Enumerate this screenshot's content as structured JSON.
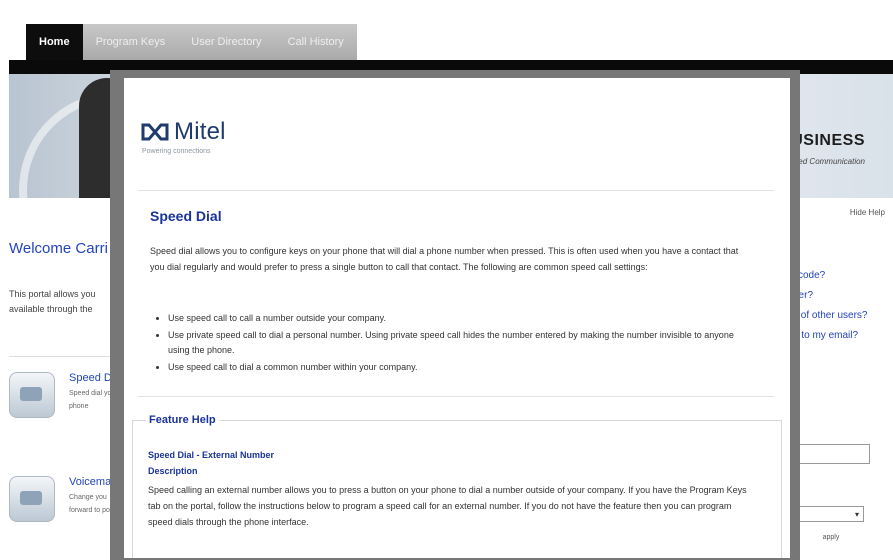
{
  "nav": {
    "tabs": [
      {
        "label": "Home",
        "active": true
      },
      {
        "label": "Program Keys",
        "active": false
      },
      {
        "label": "User Directory",
        "active": false
      },
      {
        "label": "Call History",
        "active": false
      }
    ]
  },
  "banner": {
    "title": "USINESS",
    "subtitle": "ed Communication"
  },
  "help_link": "Hide Help",
  "welcome": "Welcome Carri",
  "intro": "This portal allows you available through the",
  "features": [
    {
      "title": "Speed Di",
      "description": "Speed dial your phone",
      "icon": "speed-dial-icon"
    },
    {
      "title": "Voicemai",
      "description": "Change you forward to portal.",
      "icon": "voicemail-icon"
    }
  ],
  "right_links": [
    "scode?",
    "ber?",
    "s of other users?",
    "g to my email?"
  ],
  "right_form": {
    "select_value": "",
    "button_label": "apply"
  },
  "modal": {
    "logo_text": "Mitel",
    "tagline": "Powering connections",
    "title": "Speed Dial",
    "paragraph": "Speed dial allows you to configure keys on your phone that will dial a phone number when pressed. This is often used when you have a contact that you dial regularly and would prefer to press a single button to call that contact. The following are common speed call settings:",
    "bullets": [
      "Use speed call to call a number outside your company.",
      "Use private speed call to dial a personal number. Using private speed call hides the number entered by making the number invisible to anyone using the phone.",
      "Use speed call to dial a common number within your company."
    ],
    "feature_help": {
      "title": "Feature Help",
      "subtitle": "Speed Dial - External Number",
      "description_label": "Description",
      "body": "Speed calling an external number allows you to press a button on your phone to dial a number outside of your company. If you have the Program Keys tab on the portal, follow the instructions below to program a speed call for an external number. If you do not have the feature then you can program speed dials through the phone interface."
    }
  }
}
